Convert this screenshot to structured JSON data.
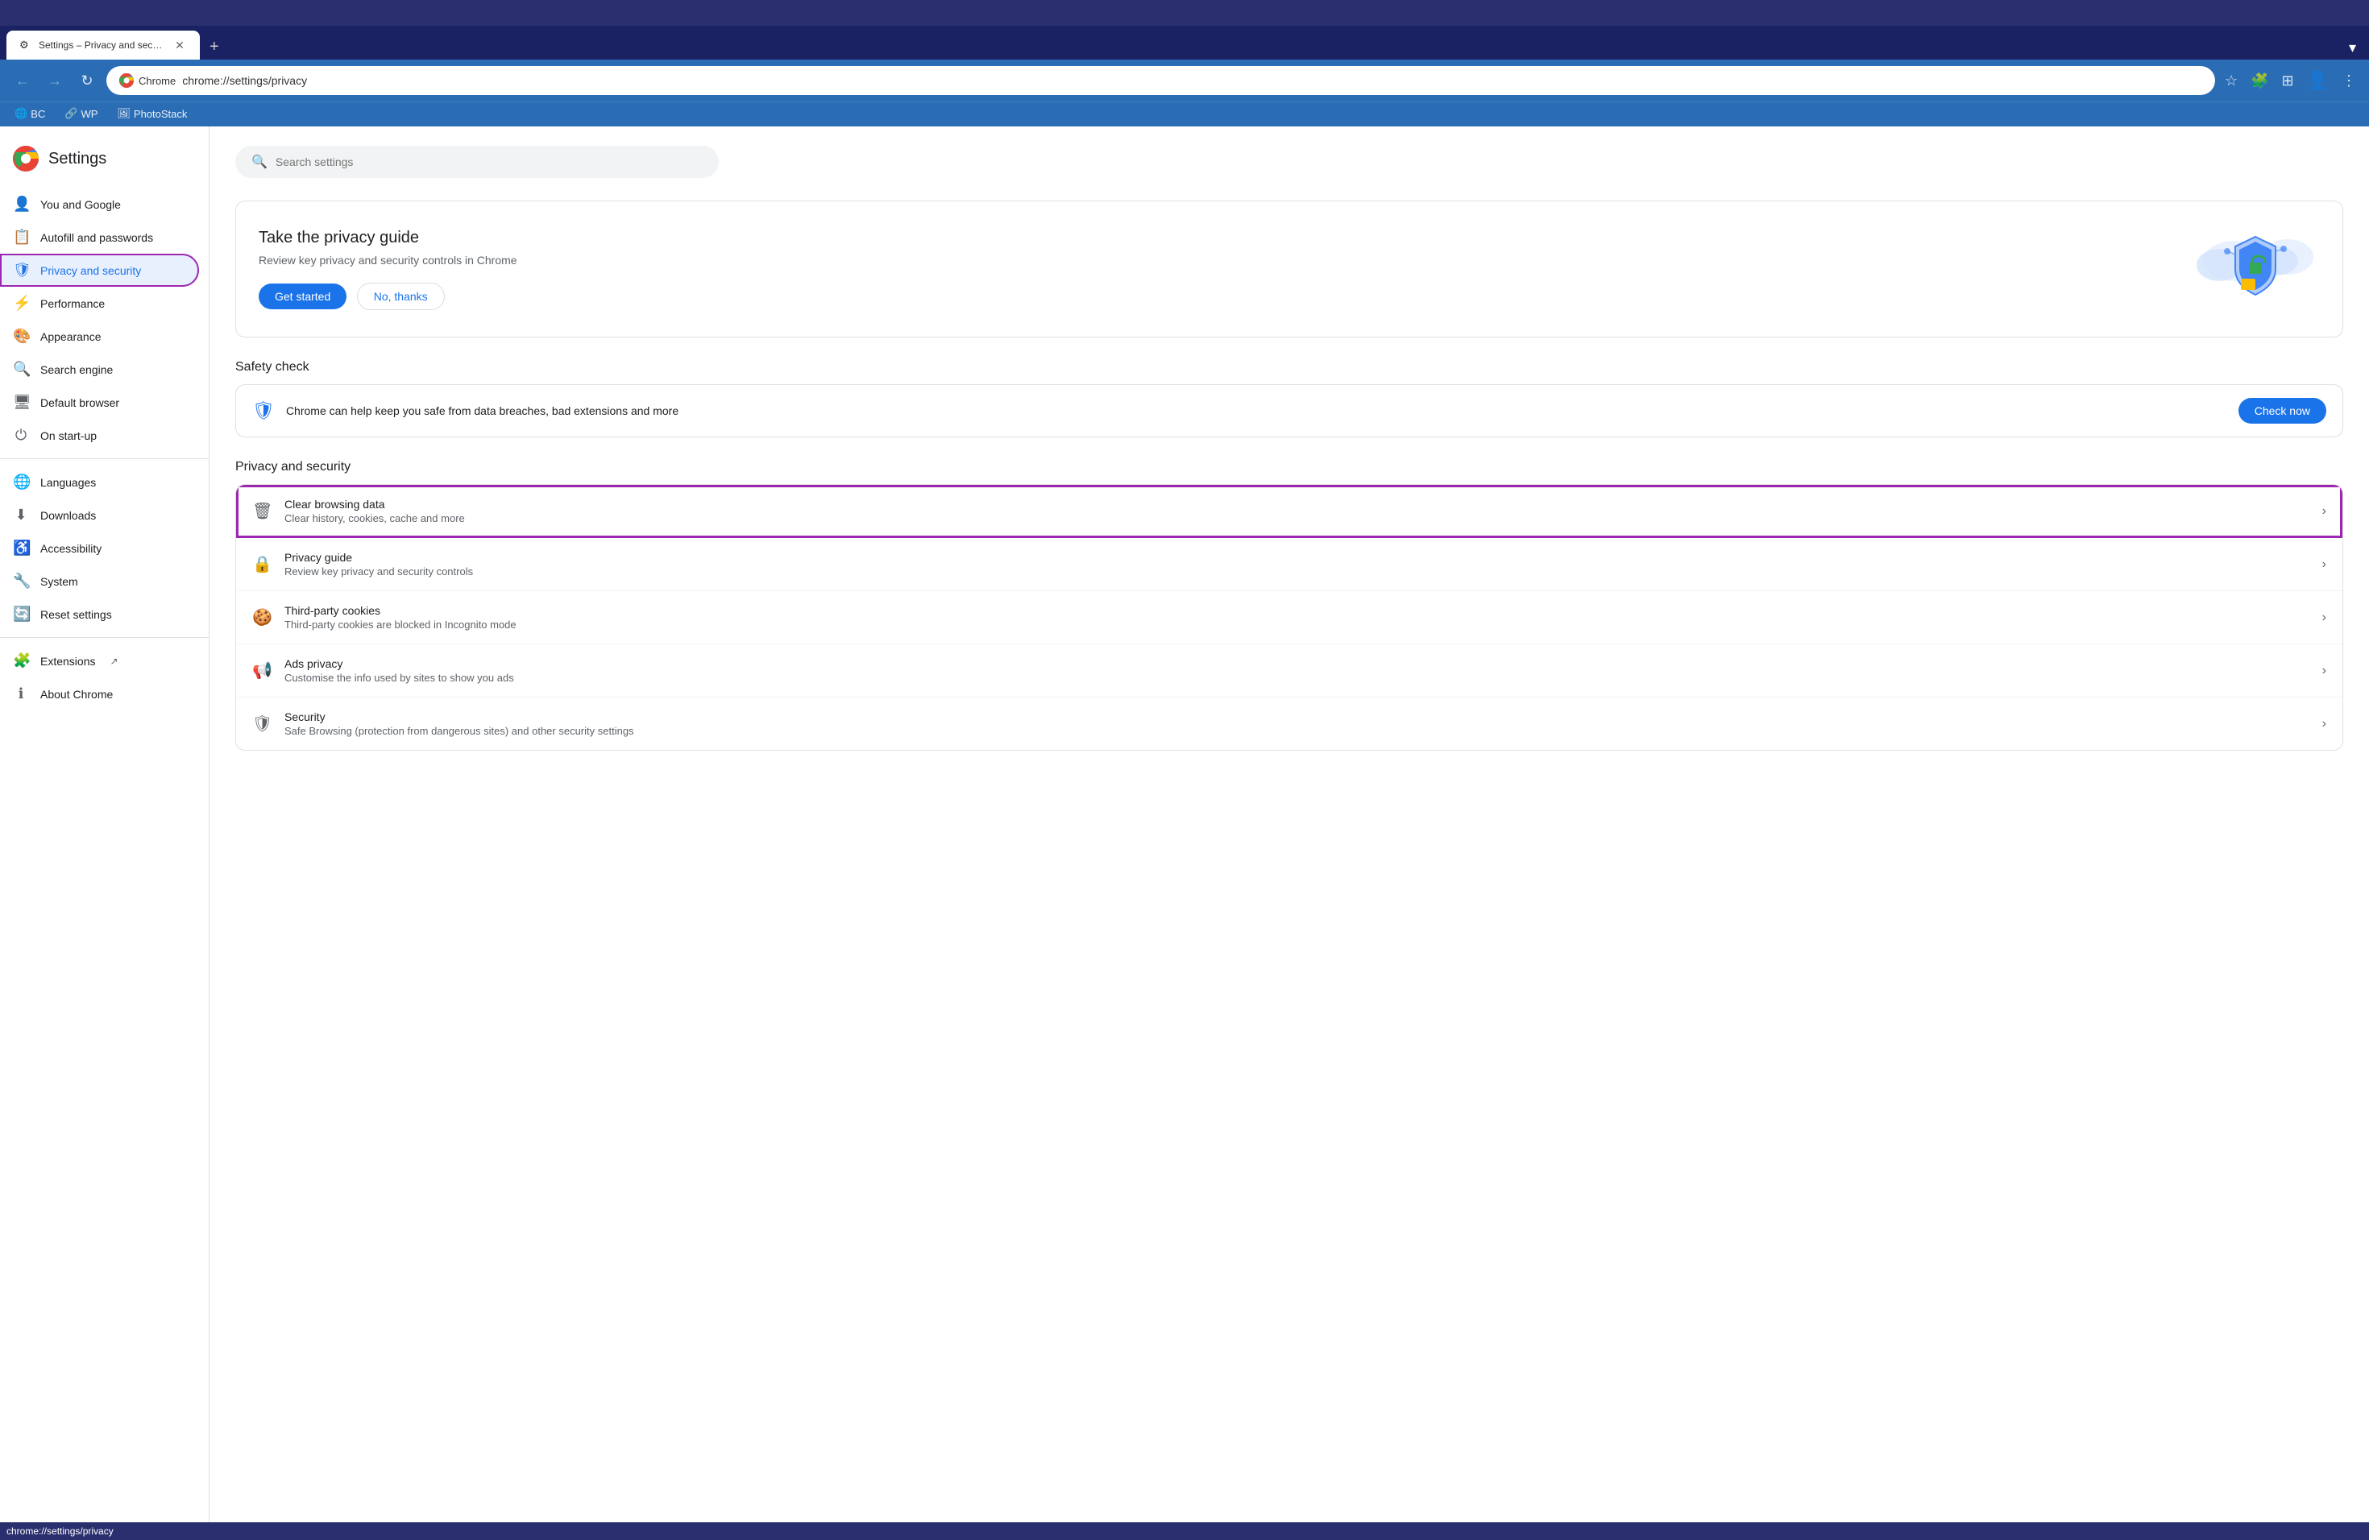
{
  "browser": {
    "tab_title": "Settings – Privacy and secu...",
    "tab_favicon": "⚙",
    "new_tab_label": "+",
    "address": "chrome://settings/privacy",
    "chrome_indicator": "Chrome",
    "back_btn": "←",
    "forward_btn": "→",
    "refresh_btn": "↻",
    "bookmarks": [
      {
        "label": "BC",
        "icon": "🌐"
      },
      {
        "label": "WP",
        "icon": "🔗"
      },
      {
        "label": "PhotoStack",
        "icon": "🖼"
      }
    ],
    "status_bar": "chrome://settings/privacy"
  },
  "sidebar": {
    "title": "Settings",
    "items": [
      {
        "id": "you-and-google",
        "label": "You and Google",
        "icon": "👤"
      },
      {
        "id": "autofill",
        "label": "Autofill and passwords",
        "icon": "📋"
      },
      {
        "id": "privacy",
        "label": "Privacy and security",
        "icon": "🛡",
        "active": true
      },
      {
        "id": "performance",
        "label": "Performance",
        "icon": "⚡"
      },
      {
        "id": "appearance",
        "label": "Appearance",
        "icon": "🎨"
      },
      {
        "id": "search-engine",
        "label": "Search engine",
        "icon": "🔍"
      },
      {
        "id": "default-browser",
        "label": "Default browser",
        "icon": "🖥"
      },
      {
        "id": "on-startup",
        "label": "On start-up",
        "icon": "⏻"
      },
      {
        "id": "languages",
        "label": "Languages",
        "icon": "🌐"
      },
      {
        "id": "downloads",
        "label": "Downloads",
        "icon": "⬇"
      },
      {
        "id": "accessibility",
        "label": "Accessibility",
        "icon": "♿"
      },
      {
        "id": "system",
        "label": "System",
        "icon": "🔧"
      },
      {
        "id": "reset-settings",
        "label": "Reset settings",
        "icon": "🔄"
      },
      {
        "id": "extensions",
        "label": "Extensions",
        "icon": "🧩"
      },
      {
        "id": "about-chrome",
        "label": "About Chrome",
        "icon": "ℹ"
      }
    ]
  },
  "main": {
    "search_placeholder": "Search settings",
    "privacy_guide_card": {
      "title": "Take the privacy guide",
      "description": "Review key privacy and security controls in Chrome",
      "btn_get_started": "Get started",
      "btn_no_thanks": "No, thanks"
    },
    "safety_check": {
      "section_title": "Safety check",
      "description": "Chrome can help keep you safe from data breaches, bad extensions and more",
      "btn_check": "Check now"
    },
    "privacy_security_section": {
      "section_title": "Privacy and security",
      "items": [
        {
          "id": "clear-browsing-data",
          "title": "Clear browsing data",
          "subtitle": "Clear history, cookies, cache and more",
          "icon": "🗑",
          "highlighted": true
        },
        {
          "id": "privacy-guide",
          "title": "Privacy guide",
          "subtitle": "Review key privacy and security controls",
          "icon": "🔒",
          "highlighted": false
        },
        {
          "id": "third-party-cookies",
          "title": "Third-party cookies",
          "subtitle": "Third-party cookies are blocked in Incognito mode",
          "icon": "🍪",
          "highlighted": false
        },
        {
          "id": "ads-privacy",
          "title": "Ads privacy",
          "subtitle": "Customise the info used by sites to show you ads",
          "icon": "📢",
          "highlighted": false
        },
        {
          "id": "security",
          "title": "Security",
          "subtitle": "Safe Browsing (protection from dangerous sites) and other security settings",
          "icon": "🛡",
          "highlighted": false
        }
      ]
    }
  }
}
